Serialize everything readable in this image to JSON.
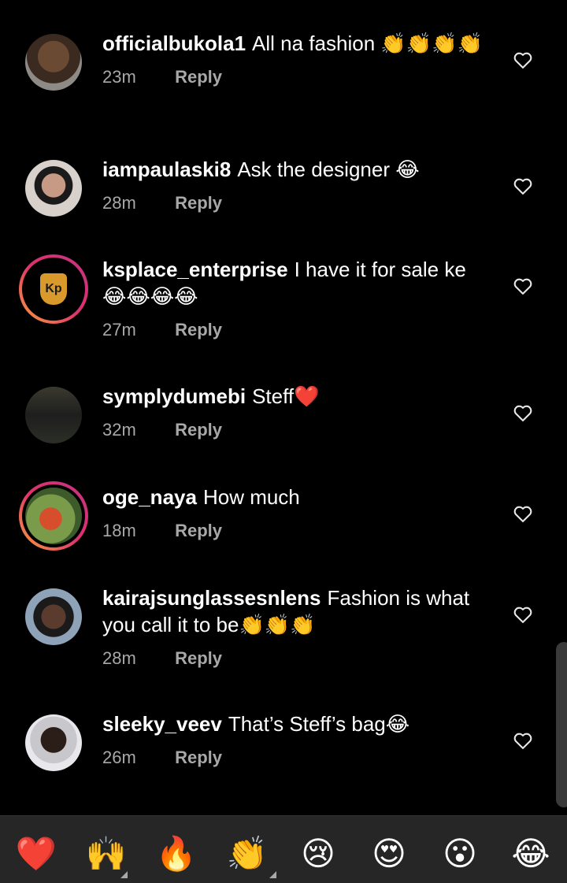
{
  "comments": [
    {
      "username": "officialbukola1",
      "text": "All na fashion",
      "emoji": "👏👏👏👏",
      "time": "23m",
      "reply": "Reply"
    },
    {
      "username": "iampaulaski8",
      "text": "Ask the designer",
      "emoji": "😂",
      "time": "28m",
      "reply": "Reply"
    },
    {
      "username": "ksplace_enterprise",
      "text": "I have it for sale ke",
      "emoji": "😂😂😂😂",
      "time": "27m",
      "reply": "Reply",
      "avatar_text": "Kp"
    },
    {
      "username": "symplydumebi",
      "text": "Steff",
      "emoji": "❤️",
      "time": "32m",
      "reply": "Reply"
    },
    {
      "username": "oge_naya",
      "text": "How much",
      "emoji": "",
      "time": "18m",
      "reply": "Reply"
    },
    {
      "username": "kairajsunglassesnlens",
      "text": "Fashion is what you call it to be",
      "emoji": "👏👏👏",
      "time": "28m",
      "reply": "Reply"
    },
    {
      "username": "sleeky_veev",
      "text": "That’s Steff’s bag",
      "emoji": "😂",
      "time": "26m",
      "reply": "Reply"
    }
  ],
  "emoji_bar": {
    "items": [
      "❤️",
      "🙌",
      "🔥",
      "👏",
      "😢",
      "😍",
      "😮",
      "😂"
    ]
  },
  "icons": {
    "like": "heart-outline-icon"
  },
  "colors": {
    "background": "#000000",
    "secondary_text": "#a8a8a8",
    "emoji_bar": "#262626",
    "story_ring": [
      "#f7a23a",
      "#e1306c",
      "#c13584"
    ]
  }
}
